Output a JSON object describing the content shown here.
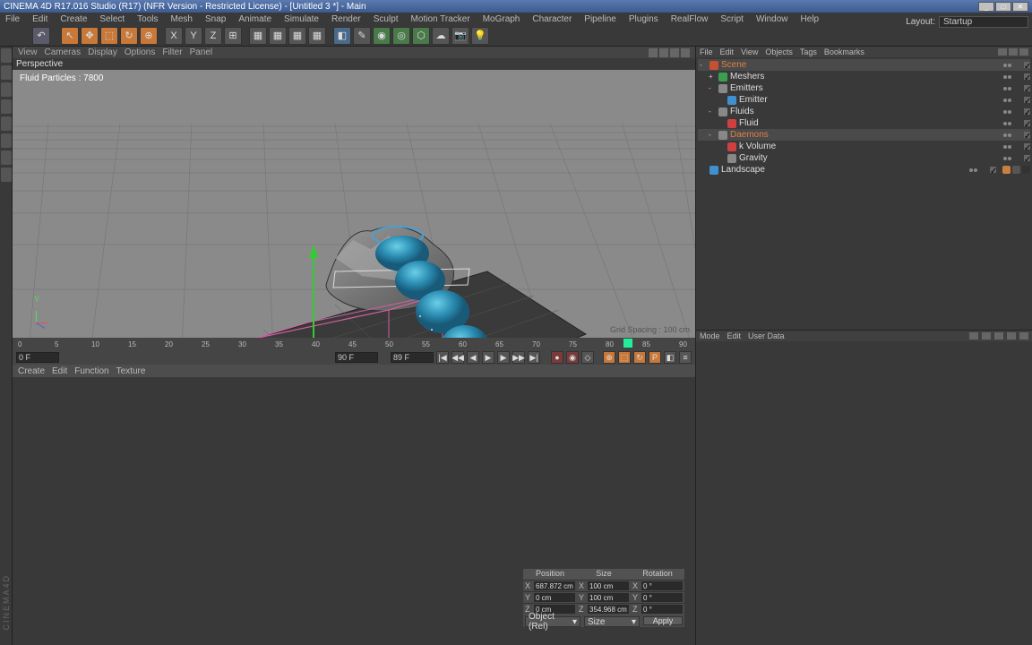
{
  "title": "CINEMA 4D R17.016 Studio (R17) (NFR Version - Restricted License) - [Untitled 3 *] - Main",
  "layout": {
    "label": "Layout:",
    "value": "Startup"
  },
  "main_menu": [
    "File",
    "Edit",
    "Create",
    "Select",
    "Tools",
    "Mesh",
    "Snap",
    "Animate",
    "Simulate",
    "Render",
    "Sculpt",
    "Motion Tracker",
    "MoGraph",
    "Character",
    "Pipeline",
    "Plugins",
    "RealFlow",
    "Script",
    "Window",
    "Help"
  ],
  "view_menu": [
    "View",
    "Cameras",
    "Display",
    "Options",
    "Filter",
    "Panel"
  ],
  "view_tab": "Perspective",
  "hud": "Fluid Particles : 7800",
  "grid_label": "Grid Spacing : 100 cm",
  "axis_y": "Y",
  "timeline": {
    "ticks": [
      0,
      5,
      10,
      15,
      20,
      25,
      30,
      35,
      40,
      45,
      50,
      55,
      60,
      65,
      70,
      75,
      80,
      85,
      90
    ],
    "current": 89,
    "suffix": "F",
    "range_start": "0 F",
    "range_end": "90 F",
    "frame_display": "89 F"
  },
  "mat_menu": [
    "Create",
    "Edit",
    "Function",
    "Texture"
  ],
  "obj_mgr_menu": [
    "File",
    "Edit",
    "View",
    "Objects",
    "Tags",
    "Bookmarks"
  ],
  "tree": [
    {
      "label": "Scene",
      "icon": "#c85030",
      "depth": 0,
      "sel": true,
      "exp": "-"
    },
    {
      "label": "Meshers",
      "icon": "#3aa050",
      "depth": 1,
      "exp": "+"
    },
    {
      "label": "Emitters",
      "icon": "#888",
      "depth": 1,
      "exp": "-"
    },
    {
      "label": "Emitter",
      "icon": "#4090d0",
      "depth": 2
    },
    {
      "label": "Fluids",
      "icon": "#888",
      "depth": 1,
      "exp": "-"
    },
    {
      "label": "Fluid",
      "icon": "#d04040",
      "depth": 2
    },
    {
      "label": "Daemons",
      "icon": "#888",
      "depth": 1,
      "exp": "-",
      "sel": true
    },
    {
      "label": "k Volume",
      "icon": "#d04040",
      "depth": 2
    },
    {
      "label": "Gravity",
      "icon": "#888",
      "depth": 2
    },
    {
      "label": "Landscape",
      "icon": "#4090d0",
      "depth": 0,
      "tags": true
    }
  ],
  "attr_menu": [
    "Mode",
    "Edit",
    "User Data"
  ],
  "coord": {
    "headers": [
      "Position",
      "Size",
      "Rotation"
    ],
    "rows": [
      {
        "axis": "X",
        "pos": "687.872 cm",
        "size": "100 cm",
        "rot": "0 °"
      },
      {
        "axis": "Y",
        "pos": "0 cm",
        "size": "100 cm",
        "rot": "0 °"
      },
      {
        "axis": "Z",
        "pos": "0 cm",
        "size": "354.968 cm",
        "rot": "0 °"
      }
    ],
    "dropdown1": "Object (Rel)",
    "dropdown2": "Size",
    "apply": "Apply"
  },
  "brand": "CINEMA4D"
}
